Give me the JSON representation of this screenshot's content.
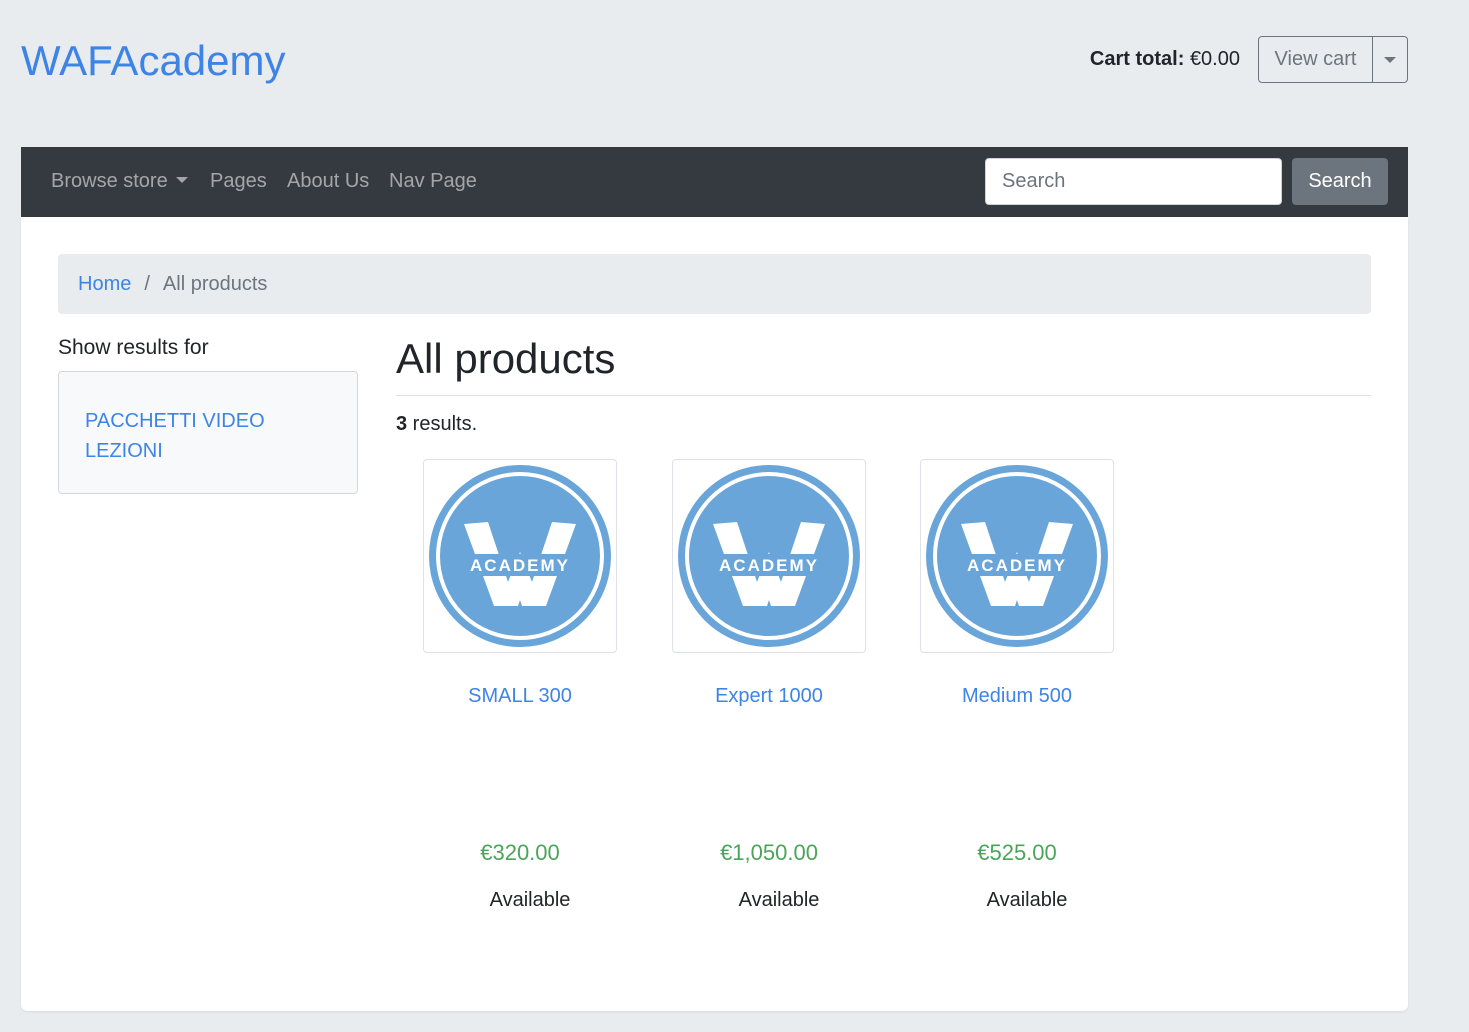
{
  "header": {
    "brand": "WAFAcademy",
    "cart_total_label": "Cart total:",
    "cart_total_value": "€0.00",
    "view_cart_label": "View cart"
  },
  "navbar": {
    "browse_store": "Browse store",
    "pages": "Pages",
    "about_us": "About Us",
    "nav_page": "Nav Page",
    "search_placeholder": "Search",
    "search_button": "Search"
  },
  "breadcrumb": {
    "home": "Home",
    "separator": "/",
    "current": "All products"
  },
  "sidebar": {
    "title": "Show results for",
    "category": "PACCHETTI VIDEO LEZIONI"
  },
  "main": {
    "title": "All products",
    "result_count": "3",
    "results_suffix": " results."
  },
  "logo": {
    "text": "ACADEMY",
    "color": "#6aa5d9"
  },
  "products": [
    {
      "name": "SMALL 300",
      "price": "€320.00",
      "status": "Available"
    },
    {
      "name": "Expert 1000",
      "price": "€1,050.00",
      "status": "Available"
    },
    {
      "name": "Medium 500",
      "price": "€525.00",
      "status": "Available"
    }
  ]
}
